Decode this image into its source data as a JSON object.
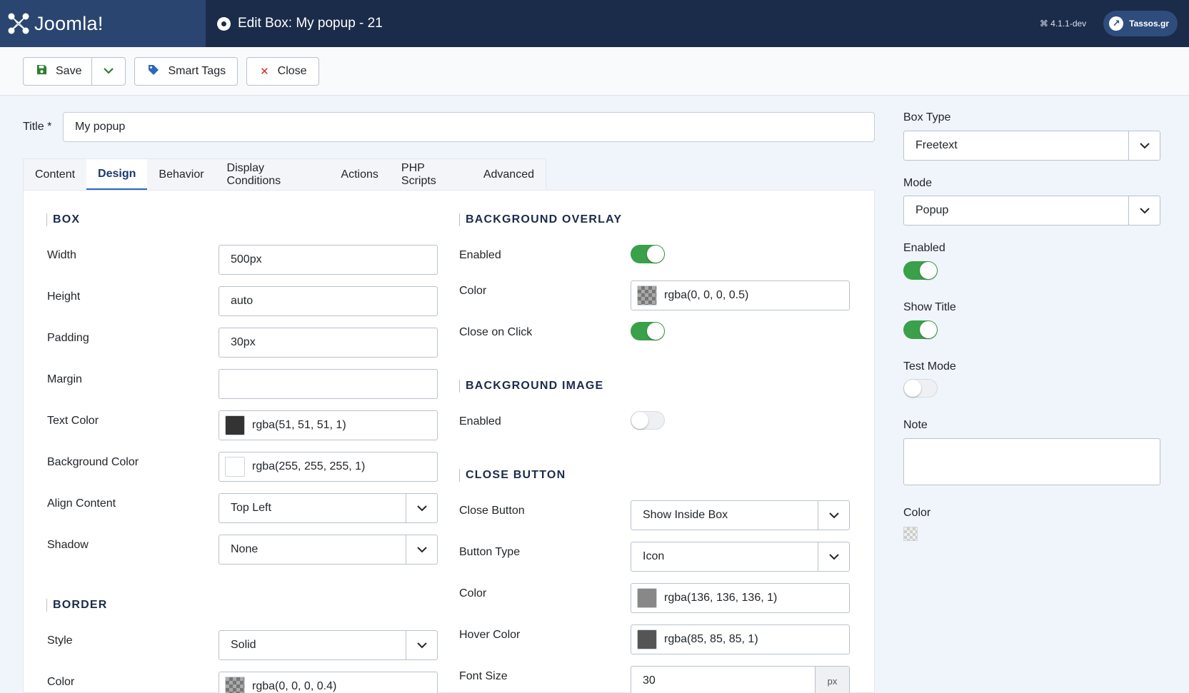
{
  "header": {
    "logo_text": "Joomla!",
    "page_title": "Edit Box: My popup - 21",
    "version": "⌘ 4.1.1-dev",
    "site_link": "Tassos.gr"
  },
  "toolbar": {
    "save_label": "Save",
    "smart_tags_label": "Smart Tags",
    "close_label": "Close"
  },
  "title_field": {
    "label": "Title *",
    "value": "My popup"
  },
  "tabs": [
    {
      "label": "Content"
    },
    {
      "label": "Design"
    },
    {
      "label": "Behavior"
    },
    {
      "label": "Display Conditions"
    },
    {
      "label": "Actions"
    },
    {
      "label": "PHP Scripts"
    },
    {
      "label": "Advanced"
    }
  ],
  "box_section": {
    "title": "BOX",
    "width": {
      "label": "Width",
      "value": "500px"
    },
    "height": {
      "label": "Height",
      "value": "auto"
    },
    "padding": {
      "label": "Padding",
      "value": "30px"
    },
    "margin": {
      "label": "Margin",
      "value": ""
    },
    "text_color": {
      "label": "Text Color",
      "value": "rgba(51, 51, 51, 1)",
      "swatch": "#333333"
    },
    "bg_color": {
      "label": "Background Color",
      "value": "rgba(255, 255, 255, 1)",
      "swatch": "#ffffff"
    },
    "align": {
      "label": "Align Content",
      "value": "Top Left"
    },
    "shadow": {
      "label": "Shadow",
      "value": "None"
    }
  },
  "border_section": {
    "title": "BORDER",
    "style": {
      "label": "Style",
      "value": "Solid"
    },
    "color": {
      "label": "Color",
      "value": "rgba(0, 0, 0, 0.4)"
    }
  },
  "overlay_section": {
    "title": "BACKGROUND OVERLAY",
    "enabled_label": "Enabled",
    "enabled": true,
    "color": {
      "label": "Color",
      "value": "rgba(0, 0, 0, 0.5)"
    },
    "close_on_click_label": "Close on Click",
    "close_on_click": true
  },
  "bg_image_section": {
    "title": "BACKGROUND IMAGE",
    "enabled_label": "Enabled",
    "enabled": false
  },
  "close_section": {
    "title": "CLOSE BUTTON",
    "close_button": {
      "label": "Close Button",
      "value": "Show Inside Box"
    },
    "button_type": {
      "label": "Button Type",
      "value": "Icon"
    },
    "color": {
      "label": "Color",
      "value": "rgba(136, 136, 136, 1)",
      "swatch": "#888888"
    },
    "hover_color": {
      "label": "Hover Color",
      "value": "rgba(85, 85, 85, 1)",
      "swatch": "#555555"
    },
    "font_size": {
      "label": "Font Size",
      "value": "30",
      "unit": "px"
    }
  },
  "sidebar": {
    "box_type": {
      "label": "Box Type",
      "value": "Freetext"
    },
    "mode": {
      "label": "Mode",
      "value": "Popup"
    },
    "enabled": {
      "label": "Enabled",
      "on": true
    },
    "show_title": {
      "label": "Show Title",
      "on": true
    },
    "test_mode": {
      "label": "Test Mode",
      "on": false
    },
    "note": {
      "label": "Note",
      "value": ""
    },
    "color": {
      "label": "Color"
    }
  },
  "colors": {
    "header_bg": "#1b2b4a",
    "logo_bg": "#2a4570",
    "toggle_on": "#3aa04a",
    "accent": "#2a69b8"
  }
}
